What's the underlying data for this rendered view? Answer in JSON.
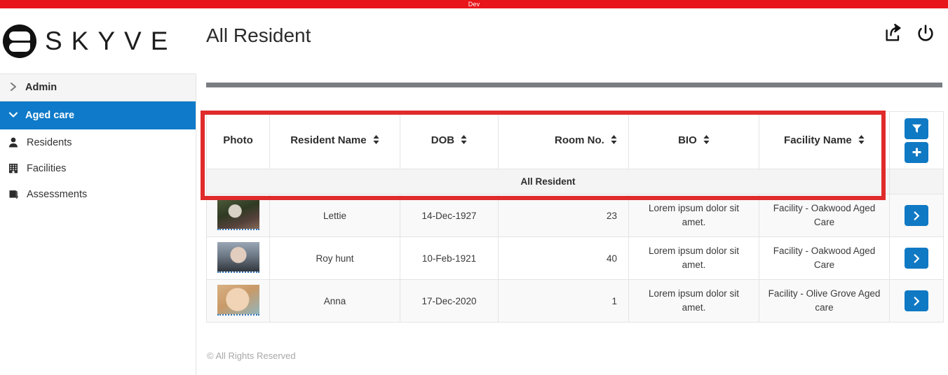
{
  "env_banner": {
    "label": "Dev",
    "color": "#e8151a"
  },
  "brand": {
    "wordmark": "SKYVE",
    "logo_icon": "skyve-logo-icon"
  },
  "header": {
    "title": "All Resident",
    "actions": [
      {
        "icon": "share-export-icon",
        "label": "Share"
      },
      {
        "icon": "power-icon",
        "label": "Logout"
      }
    ]
  },
  "sidebar": {
    "groups": [
      {
        "label": "Admin",
        "icon": "chevron-right-icon",
        "expanded": false,
        "active": false
      },
      {
        "label": "Aged care",
        "icon": "chevron-down-icon",
        "expanded": true,
        "active": true
      }
    ],
    "items": [
      {
        "label": "Residents",
        "icon": "user-icon"
      },
      {
        "label": "Facilities",
        "icon": "building-icon"
      },
      {
        "label": "Assessments",
        "icon": "book-icon"
      }
    ]
  },
  "grid": {
    "caption": "All Resident",
    "columns": [
      {
        "key": "photo",
        "label": "Photo",
        "sortable": false
      },
      {
        "key": "name",
        "label": "Resident Name",
        "sortable": true
      },
      {
        "key": "dob",
        "label": "DOB",
        "sortable": true
      },
      {
        "key": "room",
        "label": "Room No.",
        "sortable": true
      },
      {
        "key": "bio",
        "label": "BIO",
        "sortable": true
      },
      {
        "key": "facility",
        "label": "Facility Name",
        "sortable": true
      }
    ],
    "header_actions": [
      {
        "icon": "filter-icon",
        "label": "Filter"
      },
      {
        "icon": "plus-icon",
        "label": "Add"
      }
    ],
    "row_action": {
      "icon": "chevron-right-icon",
      "label": "Open"
    },
    "rows": [
      {
        "photo": "resident-photo-lettie",
        "name": "Lettie",
        "dob": "14-Dec-1927",
        "room": "23",
        "bio": "Lorem ipsum dolor sit amet.",
        "facility": "Facility - Oakwood Aged Care"
      },
      {
        "photo": "resident-photo-roy",
        "name": "Roy hunt",
        "dob": "10-Feb-1921",
        "room": "40",
        "bio": "Lorem ipsum dolor sit amet.",
        "facility": "Facility - Oakwood Aged Care"
      },
      {
        "photo": "resident-photo-anna",
        "name": "Anna",
        "dob": "17-Dec-2020",
        "room": "1",
        "bio": "Lorem ipsum dolor sit amet.",
        "facility": "Facility - Olive Grove Aged care"
      }
    ]
  },
  "footer": {
    "copyright": "© All Rights Reserved"
  },
  "colors": {
    "accent_blue": "#1079c4",
    "banner_red": "#e8151a",
    "highlight_red": "#e02b2b",
    "toolbar_gray": "#7a7e83"
  }
}
